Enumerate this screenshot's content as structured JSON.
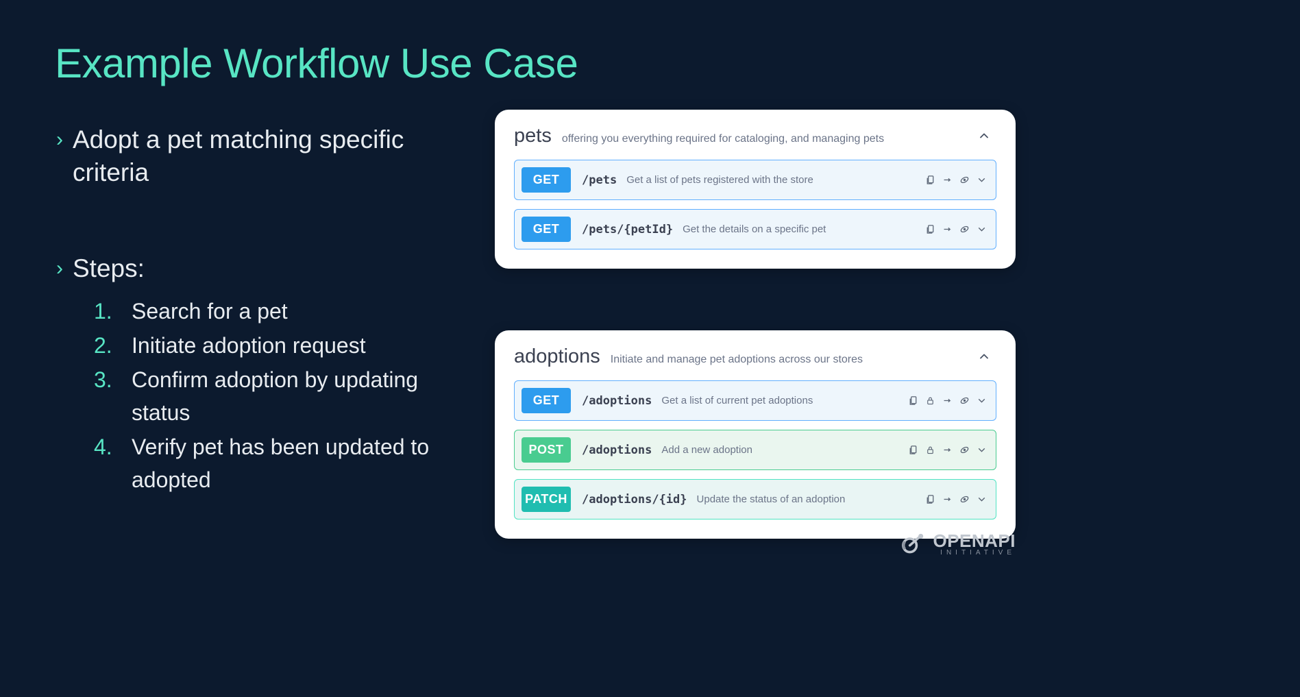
{
  "title": "Example Workflow Use Case",
  "intro": "Adopt a pet matching specific criteria",
  "steps_heading": "Steps:",
  "steps": [
    "Search for a pet",
    "Initiate adoption request",
    "Confirm adoption by updating status",
    "Verify pet has been updated to adopted"
  ],
  "panels": [
    {
      "tag": "pets",
      "description": "offering you everything required for cataloging, and managing pets",
      "endpoints": [
        {
          "method": "GET",
          "path": "/pets",
          "desc": "Get a list of pets registered with the store",
          "has_lock": false
        },
        {
          "method": "GET",
          "path": "/pets/{petId}",
          "desc": "Get the details on a specific pet",
          "has_lock": false
        }
      ]
    },
    {
      "tag": "adoptions",
      "description": "Initiate and manage pet adoptions across our stores",
      "endpoints": [
        {
          "method": "GET",
          "path": "/adoptions",
          "desc": "Get a list of current pet adoptions",
          "has_lock": true
        },
        {
          "method": "POST",
          "path": "/adoptions",
          "desc": "Add a new adoption",
          "has_lock": true
        },
        {
          "method": "PATCH",
          "path": "/adoptions/{id}",
          "desc": "Update the status of an adoption",
          "has_lock": false
        }
      ]
    }
  ],
  "logo": {
    "main": "OPENAPI",
    "sub": "INITIATIVE"
  }
}
